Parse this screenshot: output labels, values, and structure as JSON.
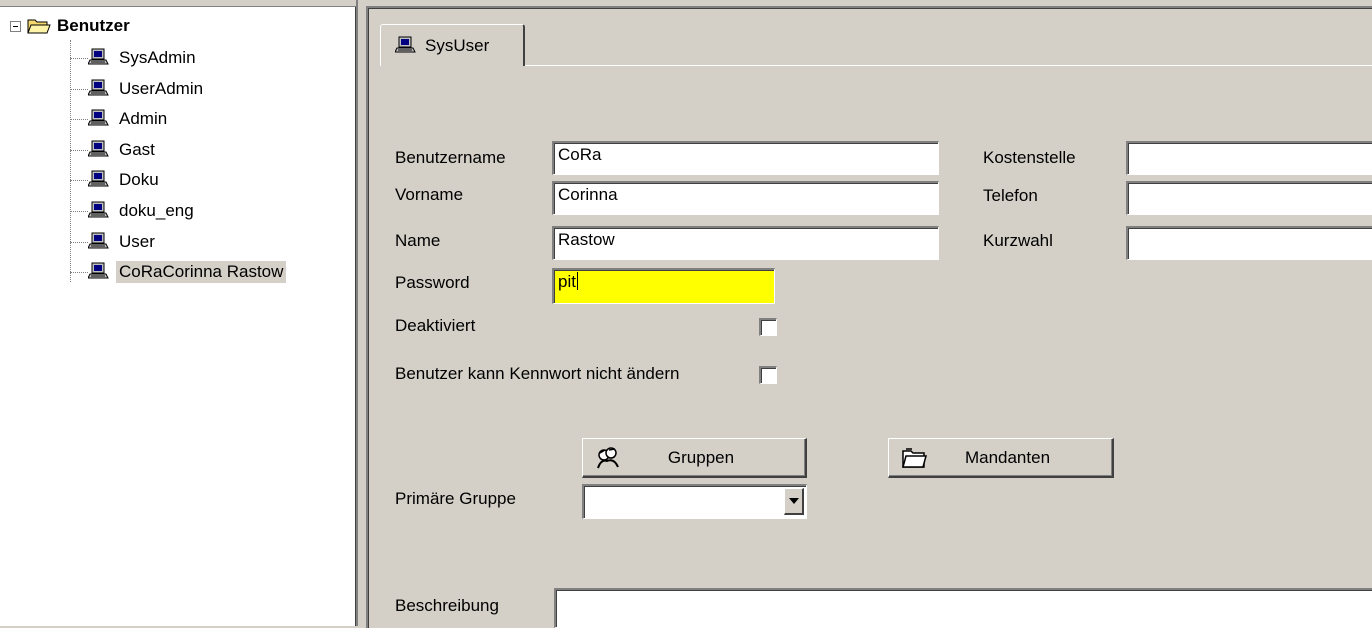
{
  "tree": {
    "root_label": "Benutzer",
    "items": [
      {
        "label": "SysAdmin"
      },
      {
        "label": "UserAdmin"
      },
      {
        "label": "Admin"
      },
      {
        "label": "Gast"
      },
      {
        "label": "Doku"
      },
      {
        "label": "doku_eng"
      },
      {
        "label": "User"
      },
      {
        "label": "CoRaCorinna Rastow"
      }
    ],
    "selected_index": 7
  },
  "tab": {
    "label": "SysUser"
  },
  "form": {
    "benutzername": {
      "label": "Benutzername",
      "value": "CoRa"
    },
    "vorname": {
      "label": "Vorname",
      "value": "Corinna"
    },
    "name": {
      "label": "Name",
      "value": "Rastow"
    },
    "password": {
      "label": "Password",
      "value": "pit"
    },
    "kostenstelle": {
      "label": "Kostenstelle",
      "value": ""
    },
    "telefon": {
      "label": "Telefon",
      "value": ""
    },
    "kurzwahl": {
      "label": "Kurzwahl",
      "value": ""
    },
    "deaktiviert": {
      "label": "Deaktiviert",
      "checked": false
    },
    "kennwort": {
      "label": "Benutzer kann Kennwort nicht ändern",
      "checked": false
    },
    "gruppen_button": "Gruppen",
    "mandanten_button": "Mandanten",
    "primaere_gruppe": {
      "label": "Primäre Gruppe",
      "value": ""
    },
    "beschreibung": {
      "label": "Beschreibung",
      "value": ""
    }
  },
  "colors": {
    "background": "#d4d0c8",
    "password_highlight": "#ffff00"
  },
  "icons": {
    "root": "folder-open-icon",
    "item": "computer-user-icon",
    "gruppen": "group-icon",
    "mandanten": "folder-icon"
  }
}
